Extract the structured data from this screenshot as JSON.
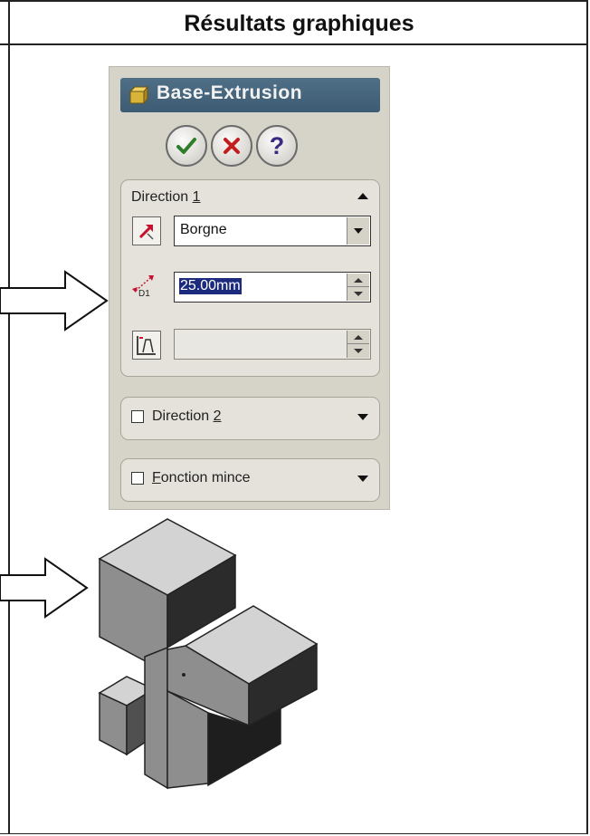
{
  "header": {
    "title": "Résultats graphiques"
  },
  "feature_panel": {
    "title": "Base-Extrusion",
    "buttons": {
      "ok_icon": "check-icon",
      "cancel_icon": "cross-icon",
      "help_icon": "question-icon",
      "help_glyph": "?"
    },
    "direction1": {
      "label_prefix": "Direction ",
      "label_hotkey": "1",
      "end_condition": "Borgne",
      "depth_value": "25.00mm",
      "depth_icon_label": "D1",
      "draft_value": ""
    },
    "direction2": {
      "label_prefix": "Direction ",
      "label_hotkey": "2",
      "checked": false
    },
    "thin_feature": {
      "label_hotkey": "F",
      "label_rest": "onction mince",
      "checked": false
    }
  },
  "colors": {
    "titlebar": "#3d5c74",
    "ok_green": "#2d7d2a",
    "cancel_red": "#c41d1d",
    "help_purple": "#3b2a82",
    "selection": "#1c2b7d"
  }
}
